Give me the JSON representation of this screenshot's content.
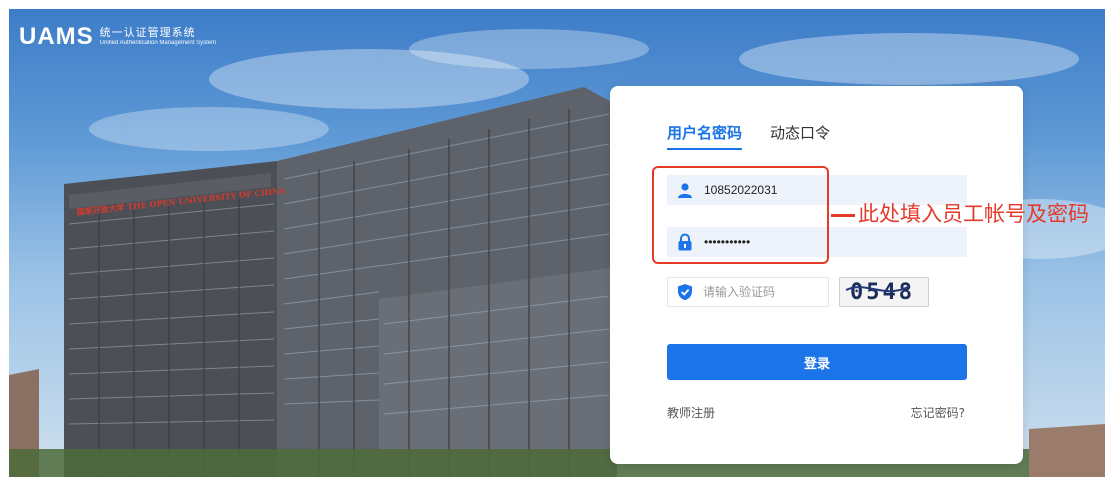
{
  "brand": {
    "mark": "UAMS",
    "title_cn": "统一认证管理系统",
    "title_en": "Unified Authentication Management System"
  },
  "background": {
    "building_sign": "国家开放大学 THE OPEN UNIVERSITY OF CHINA"
  },
  "login": {
    "tabs": [
      {
        "label": "用户名密码",
        "active": true
      },
      {
        "label": "动态口令",
        "active": false
      }
    ],
    "username": {
      "value": "10852022031",
      "icon": "user-icon"
    },
    "password": {
      "value": "•••••••••••",
      "icon": "lock-icon"
    },
    "captcha": {
      "placeholder": "请输入验证码",
      "icon": "shield-check-icon",
      "image_text": "0548"
    },
    "submit_label": "登录",
    "register_link": "教师注册",
    "forgot_link": "忘记密码?"
  },
  "annotation": {
    "text": "此处填入员工帐号及密码"
  },
  "colors": {
    "accent": "#1b74e8",
    "annotation_red": "#e53a2a",
    "field_bg": "#eef3fb"
  }
}
